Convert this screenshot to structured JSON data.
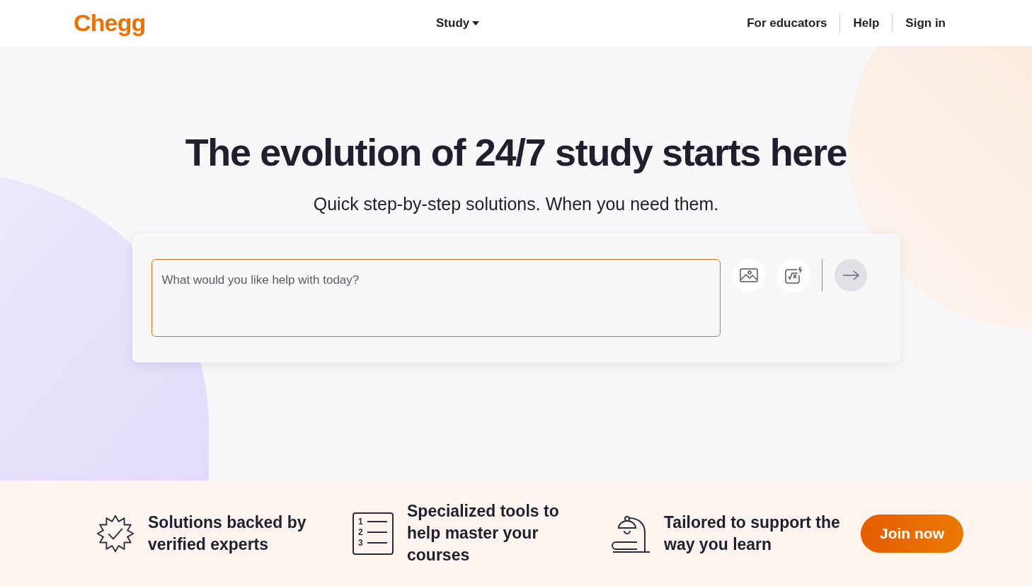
{
  "header": {
    "logo": "Chegg",
    "nav_menu": {
      "label": "Study"
    },
    "links": [
      "For educators",
      "Help",
      "Sign in"
    ]
  },
  "hero": {
    "title": "The evolution of 24/7 study starts here",
    "subtitle": "Quick step-by-step solutions. When you need them.",
    "search": {
      "placeholder": "What would you like help with today?"
    }
  },
  "features": [
    {
      "kind": "badge",
      "text": "Solutions backed by verified experts"
    },
    {
      "kind": "list",
      "text": "Specialized tools to help master your courses",
      "list_numbers": [
        "1",
        "2",
        "3"
      ]
    },
    {
      "kind": "lamp",
      "text": "Tailored to support the way you learn"
    }
  ],
  "cta": {
    "label": "Join now"
  }
}
